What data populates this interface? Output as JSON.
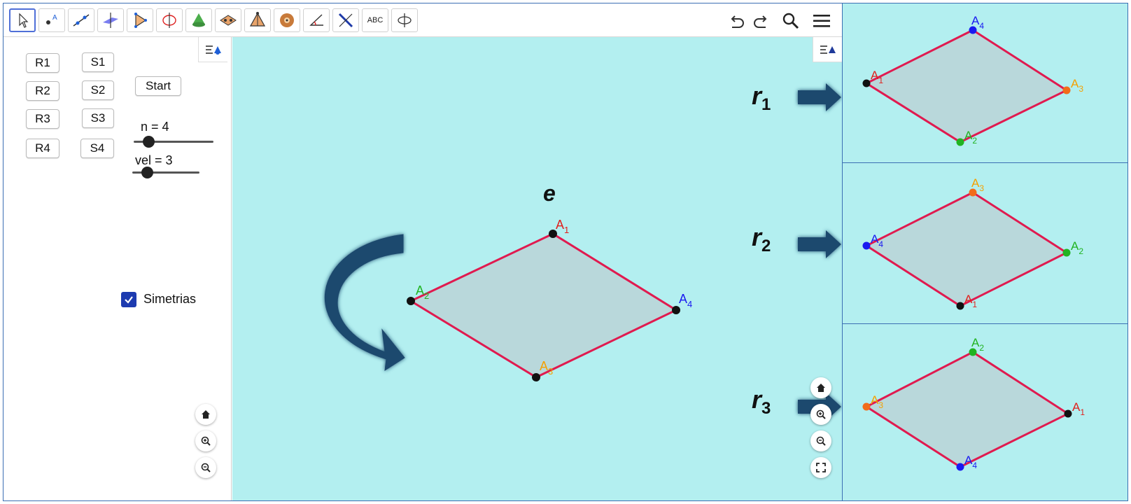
{
  "toolbar": {
    "tools": [
      {
        "icon": "move-cursor-icon",
        "selected": true
      },
      {
        "icon": "point-icon"
      },
      {
        "icon": "line-icon"
      },
      {
        "icon": "plane-icon"
      },
      {
        "icon": "polygon-icon"
      },
      {
        "icon": "circle-axis-icon"
      },
      {
        "icon": "cone-icon"
      },
      {
        "icon": "net-icon"
      },
      {
        "icon": "pyramid-icon"
      },
      {
        "icon": "sphere-icon"
      },
      {
        "icon": "angle-icon"
      },
      {
        "icon": "reflect-icon"
      },
      {
        "icon": "text-abc-icon",
        "label": "ABC"
      },
      {
        "icon": "rotate-view-icon"
      }
    ],
    "right_icons": [
      "undo-icon",
      "redo-icon",
      "search-icon",
      "menu-icon"
    ]
  },
  "algebra_panel": {
    "buttons": {
      "r1": "R1",
      "r2": "R2",
      "r3": "R3",
      "r4": "R4",
      "s1": "S1",
      "s2": "S2",
      "s3": "S3",
      "s4": "S4",
      "start": "Start"
    },
    "slider_n": {
      "label": "n = 4",
      "value": 4
    },
    "slider_vel": {
      "label": "vel = 3",
      "value": 3
    },
    "checkbox": {
      "label": "Simetrias",
      "checked": true
    }
  },
  "main_view": {
    "label_e": "e",
    "quadrilateral": {
      "vertices": {
        "A1": {
          "main": "A",
          "sub": "1",
          "color": "#e0201c"
        },
        "A2": {
          "main": "A",
          "sub": "2",
          "color": "#21b321"
        },
        "A3": {
          "main": "A",
          "sub": "3",
          "color": "#f5a000"
        },
        "A4": {
          "main": "A",
          "sub": "4",
          "color": "#1a1af0"
        }
      },
      "edge_color": "#e01a4f",
      "fill_color": "#b9d8db"
    }
  },
  "side_views": [
    {
      "label_main": "r",
      "label_sub": "1",
      "order": [
        "A1",
        "A2",
        "A3",
        "A4"
      ]
    },
    {
      "label_main": "r",
      "label_sub": "2",
      "order": [
        "A4",
        "A1",
        "A2",
        "A3"
      ]
    },
    {
      "label_main": "r",
      "label_sub": "3",
      "order": [
        "A3",
        "A4",
        "A1",
        "A2"
      ]
    }
  ],
  "colors": {
    "background": "#b3eff0",
    "arrow_fill": "#1e4a6e",
    "panel_border": "#3b6fb3"
  }
}
